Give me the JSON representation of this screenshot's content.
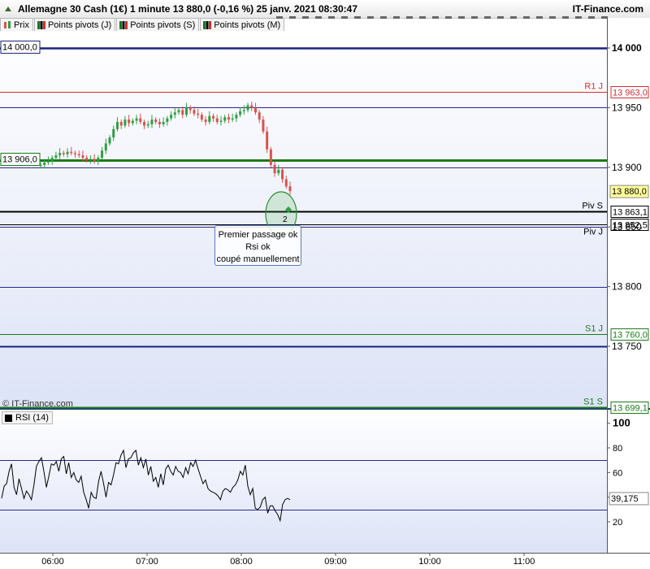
{
  "header": {
    "title": "Allemagne 30 Cash (1€) 1 minute 13 880,0 (-0,16 %) 25 janv. 2021 08:30:47",
    "brand": "IT-Finance.com"
  },
  "legend": [
    {
      "label": "Prix",
      "icon": "candles-icon"
    },
    {
      "label": "Points pivots (J)",
      "icon": "pivot-icon"
    },
    {
      "label": "Points pivots (S)",
      "icon": "pivot-icon"
    },
    {
      "label": "Points pivots (M)",
      "icon": "pivot-icon"
    }
  ],
  "watermark": "© IT-Finance.com",
  "annotation": {
    "lines": [
      "Premier passage ok",
      "Rsi ok",
      "coupé manuellement"
    ],
    "marker": "2"
  },
  "colors": {
    "bull": "#2ea043",
    "bear": "#d9534f",
    "pivot_blue": "#1a237e",
    "pivot_green": "#1b7a1b",
    "rsi_band": "#2a2a8a",
    "price_tag": "#ffff99"
  },
  "chart_data": [
    {
      "type": "candlestick",
      "title": "Allemagne 30 Cash (1€) 1 minute",
      "ylim": [
        13690,
        14015
      ],
      "x_ticks": [
        "06:00",
        "07:00",
        "08:00",
        "09:00",
        "10:00",
        "11:00"
      ],
      "y_ticks": [
        "14 000",
        "13 950",
        "13 900",
        "13 850",
        "13 800",
        "13 750"
      ],
      "series_close": [
        13902,
        13904,
        13905,
        13908,
        13910,
        13912,
        13911,
        13913,
        13912,
        13911,
        13910,
        13908,
        13906,
        13907,
        13905,
        13908,
        13914,
        13920,
        13925,
        13932,
        13938,
        13935,
        13940,
        13937,
        13939,
        13941,
        13938,
        13935,
        13936,
        13940,
        13938,
        13936,
        13938,
        13941,
        13944,
        13946,
        13948,
        13944,
        13950,
        13948,
        13945,
        13944,
        13940,
        13938,
        13943,
        13941,
        13938,
        13939,
        13942,
        13940,
        13941,
        13944,
        13947,
        13948,
        13952,
        13950,
        13946,
        13940,
        13930,
        13915,
        13902,
        13895,
        13898,
        13890,
        13884,
        13880
      ],
      "current_price": {
        "value": 13880.0,
        "label": "13 880,0"
      },
      "levels": [
        {
          "value": 14000.0,
          "label": "14 000,0",
          "name": "",
          "color": "#1a237e",
          "width": 2.5,
          "side": "left"
        },
        {
          "value": 13963.0,
          "label": "13 963,0",
          "name": "R1 J",
          "color": "#d32f2f",
          "width": 1,
          "side": "right"
        },
        {
          "value": 13950.0,
          "label": "",
          "name": "",
          "color": "#2a2a8a",
          "width": 1,
          "side": "none"
        },
        {
          "value": 13906.0,
          "label": "13 906,0",
          "name": "",
          "color": "#1b7a1b",
          "width": 3,
          "side": "left"
        },
        {
          "value": 13900.0,
          "label": "",
          "name": "",
          "color": "#2a2a8a",
          "width": 1,
          "side": "none"
        },
        {
          "value": 13863.1,
          "label": "13 863,1",
          "name": "Piv S",
          "color": "#000000",
          "width": 2,
          "side": "right"
        },
        {
          "value": 13852.5,
          "label": "13 852,5",
          "name": "Piv J",
          "color": "#000000",
          "width": 1,
          "side": "right"
        },
        {
          "value": 13850.0,
          "label": "",
          "name": "",
          "color": "#2a2a8a",
          "width": 1,
          "side": "none"
        },
        {
          "value": 13800.0,
          "label": "",
          "name": "",
          "color": "#2a2a8a",
          "width": 1,
          "side": "none"
        },
        {
          "value": 13760.0,
          "label": "13 760,0",
          "name": "S1 J",
          "color": "#1b7a1b",
          "width": 1,
          "side": "right"
        },
        {
          "value": 13750.0,
          "label": "",
          "name": "",
          "color": "#1a237e",
          "width": 2,
          "side": "none"
        },
        {
          "value": 13699.1,
          "label": "13 699,1",
          "name": "S1 S",
          "color": "#1b7a1b",
          "width": 2,
          "side": "right"
        }
      ]
    },
    {
      "type": "line",
      "title": "RSI (14)",
      "ylim": [
        0,
        110
      ],
      "y_ticks": [
        "100",
        "80",
        "60",
        "40",
        "20"
      ],
      "bands": [
        70,
        30
      ],
      "current": "39,175",
      "values": [
        39,
        49,
        51,
        61,
        67,
        48,
        42,
        55,
        47,
        39,
        45,
        42,
        38,
        50,
        65,
        69,
        72,
        61,
        48,
        57,
        67,
        66,
        69,
        61,
        71,
        73,
        59,
        68,
        56,
        60,
        54,
        52,
        57,
        44,
        38,
        31,
        44,
        40,
        39,
        53,
        61,
        51,
        40,
        52,
        50,
        58,
        68,
        67,
        74,
        78,
        64,
        71,
        72,
        76,
        78,
        66,
        72,
        64,
        71,
        58,
        65,
        53,
        56,
        48,
        59,
        50,
        63,
        66,
        61,
        58,
        65,
        61,
        60,
        56,
        64,
        59,
        68,
        65,
        70,
        63,
        57,
        51,
        54,
        47,
        45,
        44,
        43,
        41,
        38,
        45,
        47,
        46,
        44,
        48,
        50,
        54,
        61,
        58,
        66,
        49,
        42,
        47,
        31,
        30,
        32,
        38,
        40,
        27,
        33,
        33,
        29,
        26,
        21,
        34,
        38,
        39,
        38
      ]
    }
  ]
}
